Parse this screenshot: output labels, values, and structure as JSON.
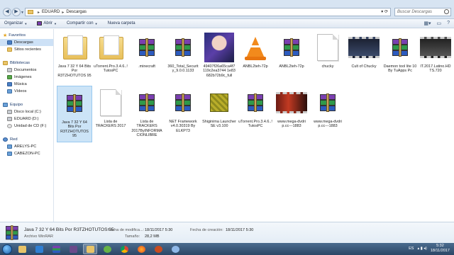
{
  "address": {
    "segments": [
      "EDUARD",
      "Descargas"
    ],
    "search_placeholder": "Buscar Descargas"
  },
  "toolbar": {
    "organize": "Organizar",
    "open": "Abrir",
    "share": "Compartir con",
    "new_folder": "Nueva carpeta"
  },
  "sidebar": {
    "favorites": "Favoritos",
    "downloads": "Descargas",
    "recent": "Sitios recientes",
    "libraries": "Bibliotecas",
    "documents": "Documentos",
    "images": "Imágenes",
    "music": "Música",
    "videos": "Vídeos",
    "computer": "Equipo",
    "local_disk": "Disco local (C:)",
    "eduard_d": "EDUARD (D:)",
    "cd_drive": "Unidad de CD (F:)",
    "network": "Red",
    "arelys": "ARELYS-PC",
    "cabezon": "CABEZON-PC"
  },
  "files": {
    "f1": "Java 7 32 Y 64 Bits Por R3TZHOTUTOS 95",
    "f2": "uTorrent.Pro.3.4.6..!TutosPC",
    "f3": ".minecraft",
    "f4": "360_Total_Securit y_9.0.0.1133",
    "f5": "49407f26a65ca4f7 119c2ea3744 1e83 682b72b9c_full",
    "f6": "ANBL2teh-72p",
    "f7": "ANBL2teh-72p",
    "f8": "chucky",
    "f9": "Cult of Chucky",
    "f10": "Daemon tool lite 10 By TuApps Pc",
    "f11": "IT.2017.Latino.HD TS.720",
    "f12": "Java 7 32 Y 64 Bits Por R3TZHOTUTOS 95",
    "f13": "Lista de TRACKERS 2017",
    "f14": "Lista de TRACKERS 2017ByINFORMA CIONLIBRE",
    "f15": "NET Framework v4.0.30319 By ELKP73",
    "f16": "Shiginima Launcher SE v3.100",
    "f17": "uTorrent.Pro.3.4.6..!TutosPC",
    "f18": "www.mega-dvdri p.cc---1883",
    "f19": "www.mega-dvdri p.cc---1883"
  },
  "details": {
    "name": "Java 7 32 Y 64 Bits Por R3TZHOTUTOS 95",
    "type": "Archivo WinRAR",
    "modified_label": "Fecha de modifica...:",
    "modified_value": "18/11/2017 5:30",
    "size_label": "Tamaño:",
    "size_value": "28,2 MB",
    "created_label": "Fecha de creación:",
    "created_value": "18/11/2017 5:30"
  },
  "taskbar": {
    "lang": "ES",
    "time": "5:32",
    "date": "18/11/2017"
  },
  "colors": {
    "selection": "#cce4f7",
    "taskbar": "#2c4766",
    "folder": "#e8c46a"
  }
}
